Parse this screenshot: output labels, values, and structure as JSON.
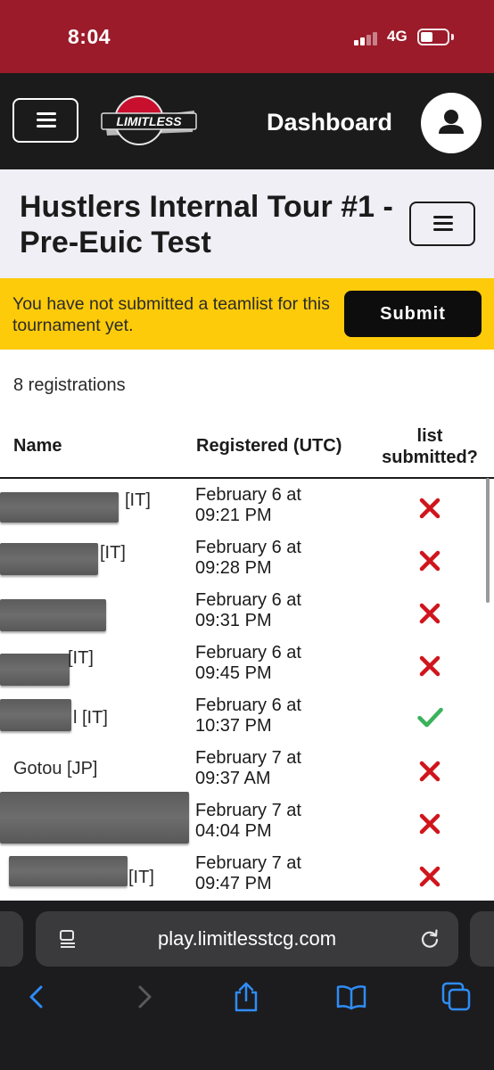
{
  "status_bar": {
    "time": "8:04",
    "network": "4G"
  },
  "nav": {
    "title": "Dashboard",
    "logo_text": "LIMITLESS"
  },
  "tournament": {
    "title": "Hustlers Internal Tour #1 - Pre-Euic Test"
  },
  "banner": {
    "message": "You have not submitted a teamlist for this tournament yet.",
    "submit_label": "Submit"
  },
  "registrations": {
    "count_text": "8 registrations"
  },
  "table": {
    "headers": {
      "name": "Name",
      "registered": "Registered (UTC)",
      "list": "list submitted?"
    },
    "rows": [
      {
        "name": "[IT]",
        "date": "February 6 at",
        "time": "09:21 PM",
        "submitted": false
      },
      {
        "name": "[IT]",
        "date": "February 6 at",
        "time": "09:28 PM",
        "submitted": false
      },
      {
        "name": "",
        "date": "February 6 at",
        "time": "09:31 PM",
        "submitted": false
      },
      {
        "name": "[IT]",
        "date": "February 6 at",
        "time": "09:45 PM",
        "submitted": false
      },
      {
        "name": "l [IT]",
        "date": "February 6 at",
        "time": "10:37 PM",
        "submitted": true
      },
      {
        "name": "Gotou [JP]",
        "date": "February 7 at",
        "time": "09:37 AM",
        "submitted": false
      },
      {
        "name": "",
        "date": "February 7 at",
        "time": "04:04 PM",
        "submitted": false
      },
      {
        "name": "[IT]",
        "date": "February 7 at",
        "time": "09:47 PM",
        "submitted": false
      }
    ]
  },
  "browser": {
    "url": "play.limitlesstcg.com"
  },
  "colors": {
    "status_bar": "#9b1b2a",
    "nav": "#1b1b1b",
    "banner": "#fdcb0a",
    "cross": "#d0151c",
    "check": "#3ab35c"
  },
  "icons": [
    "menu-icon",
    "user-icon",
    "cross-icon",
    "check-icon",
    "reader-icon",
    "reload-icon",
    "back-icon",
    "forward-icon",
    "share-icon",
    "bookmarks-icon",
    "tabs-icon"
  ]
}
